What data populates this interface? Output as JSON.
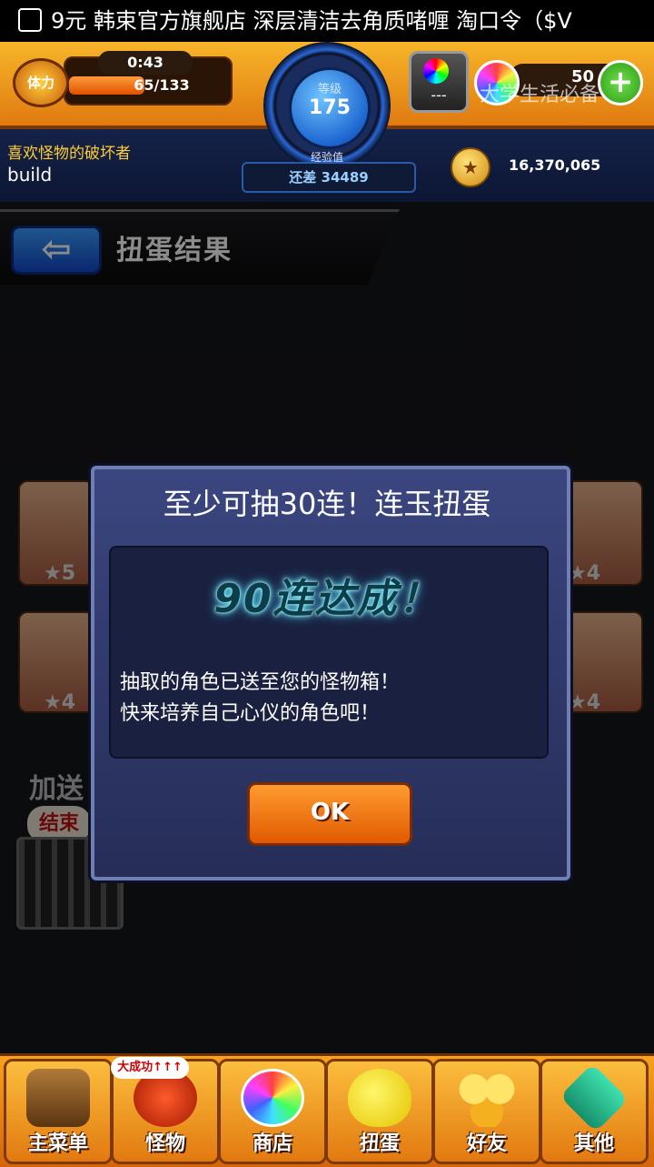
{
  "status_bar": {
    "text": "9元 韩束官方旗舰店 深层清洁去角质啫喱 淘口令（$V"
  },
  "header": {
    "stamina_label": "体力",
    "timer": "0:43",
    "stamina": "65/133",
    "stamina_fraction": 0.49,
    "level_label": "等级",
    "level": "175",
    "exp_label": "经验值",
    "exp_remaining": "还差 34489",
    "lock_text": "---",
    "orb_count": "50",
    "plus": "+",
    "watermark": "大学生活必备",
    "player_title": "喜欢怪物的破坏者",
    "player_name": "build",
    "coin_glyph": "★",
    "coins": "16,370,065"
  },
  "page": {
    "back_glyph": "⇦",
    "title": "扭蛋结果"
  },
  "background": {
    "stars": [
      "★5",
      "★4",
      "★4",
      "★4"
    ],
    "partial_text": "加送",
    "partial_badge": "结束"
  },
  "dialog": {
    "title": "至少可抽30连！连玉扭蛋",
    "achievement": "90连达成！",
    "message_line1": "抽取的角色已送至您的怪物箱！",
    "message_line2": "快来培养自己心仪的角色吧！",
    "ok_label": "OK"
  },
  "nav": {
    "badge": "大成功↑↑↑",
    "items": [
      {
        "label": "主菜单"
      },
      {
        "label": "怪物"
      },
      {
        "label": "商店"
      },
      {
        "label": "扭蛋"
      },
      {
        "label": "好友"
      },
      {
        "label": "其他"
      }
    ]
  },
  "colors": {
    "accent_orange": "#f09020",
    "dialog_blue": "#303a6e",
    "glow_cyan": "#3fd8ff"
  }
}
